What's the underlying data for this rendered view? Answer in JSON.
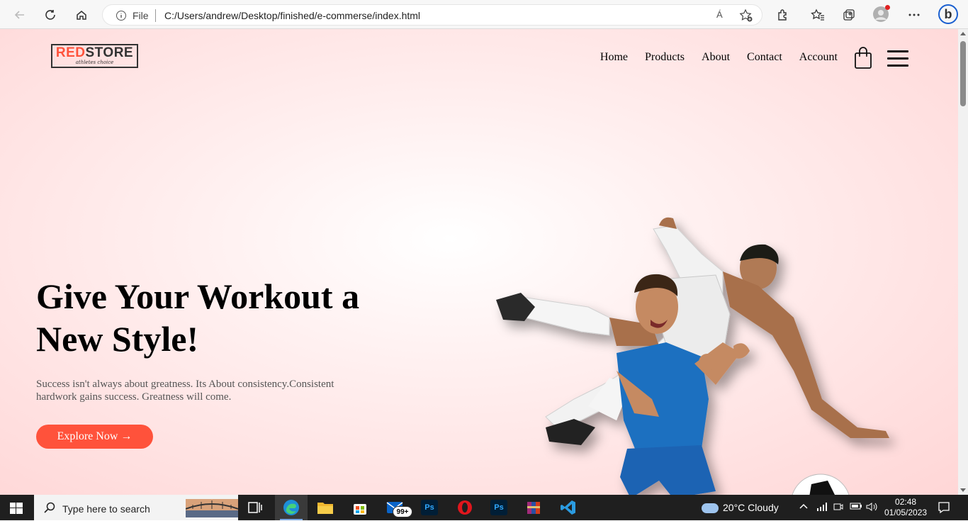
{
  "browser": {
    "address_scheme": "File",
    "url": "C:/Users/andrew/Desktop/finished/e-commerse/index.html",
    "read_aloud": "Á"
  },
  "site": {
    "logo": {
      "red": "RED",
      "rest": "STORE",
      "tagline": "athletes choice"
    },
    "nav": [
      "Home",
      "Products",
      "About",
      "Contact",
      "Account"
    ],
    "hero": {
      "title_line1": "Give Your Workout a",
      "title_line2": "New Style!",
      "text": "Success isn't always about greatness. Its About consistency.Consistent hardwork gains success. Greatness will come.",
      "button": "Explore Now →"
    },
    "colors": {
      "accent": "#ff523b",
      "background": "#ffd6d6"
    }
  },
  "taskbar": {
    "search_placeholder": "Type here to search",
    "mail_badge": "99+",
    "weather": "20°C  Cloudy",
    "time": "02:48",
    "date": "01/05/2023",
    "apps": [
      "task-view-icon",
      "edge-icon",
      "file-explorer-icon",
      "store-icon",
      "mail-icon",
      "photoshop-icon",
      "opera-icon",
      "photoshop-icon",
      "winrar-icon",
      "vscode-icon"
    ]
  }
}
